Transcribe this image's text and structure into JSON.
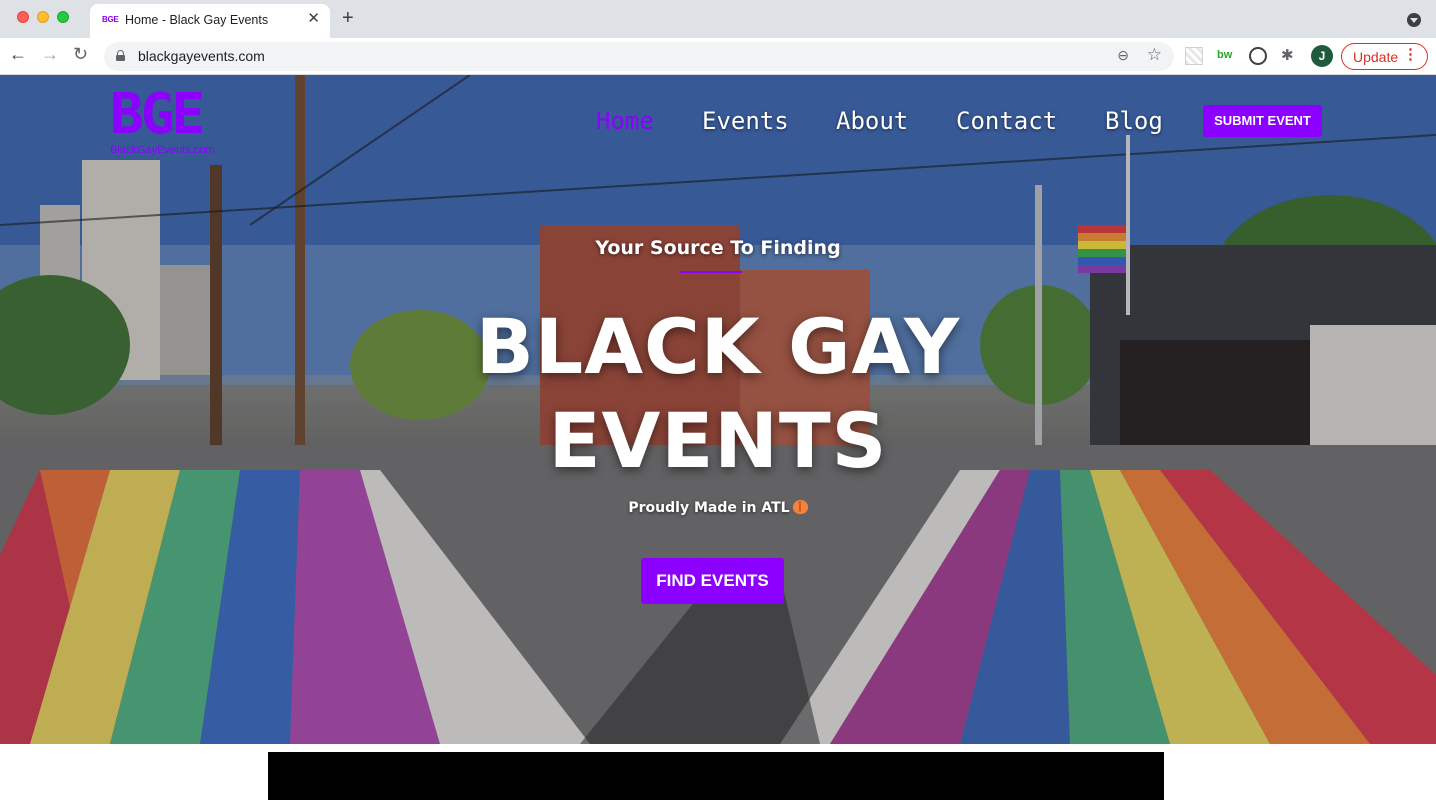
{
  "browser": {
    "tab_title": "Home - Black Gay Events",
    "tab_favicon": "BGE",
    "url": "blackgayevents.com",
    "profile_initial": "J",
    "update_label": "Update",
    "icons": [
      "back-icon",
      "forward-icon",
      "reload-icon",
      "lock-icon",
      "zoom-icon",
      "star-icon",
      "extensions-icon",
      "menu-dots-icon"
    ]
  },
  "site": {
    "logo_mark": "BGE",
    "logo_sub": "BlackGayEvents.com",
    "nav": [
      {
        "label": "Home",
        "active": true
      },
      {
        "label": "Events"
      },
      {
        "label": "About"
      },
      {
        "label": "Contact"
      },
      {
        "label": "Blog"
      }
    ],
    "submit_label": "SUBMIT EVENT",
    "accent_color": "#8b00ff"
  },
  "hero": {
    "eyebrow": "Your Source To Finding",
    "headline_line1": "BLACK GAY",
    "headline_line2": "EVENTS",
    "tagline": "Proudly Made in ATL",
    "tagline_emoji": "peach-icon",
    "cta_label": "FIND EVENTS"
  }
}
